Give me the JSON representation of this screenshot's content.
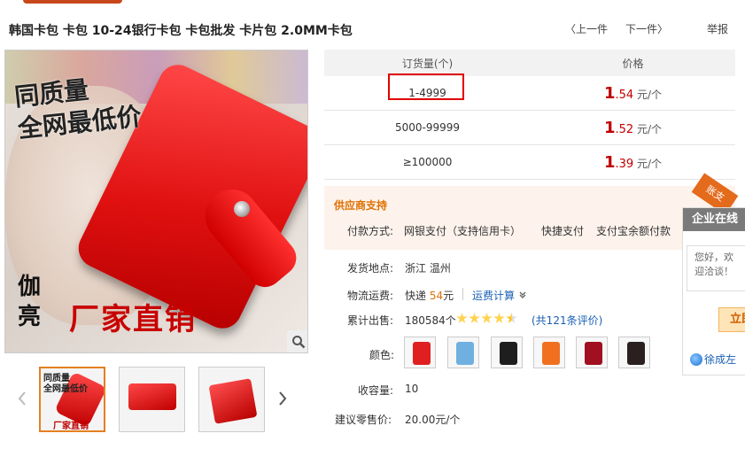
{
  "product": {
    "title": "韩国卡包 卡包 10-24银行卡包 卡包批发 卡片包 2.0MM卡包"
  },
  "nav": {
    "prev": "〈上一件",
    "next": "下一件〉",
    "report": "举报"
  },
  "image": {
    "promo_line1": "同质量",
    "promo_line2": "全网最低价",
    "brand_chars": "伽亮",
    "promo_bottom": "厂家直销",
    "thumbs": [
      {
        "line1": "同质量",
        "line2": "全网最低价",
        "bottom": "厂家直销"
      },
      {
        "line1": "",
        "line2": "",
        "bottom": ""
      },
      {
        "line1": "",
        "line2": "",
        "bottom": ""
      }
    ]
  },
  "price_table": {
    "col_qty": "订货量(个)",
    "col_price": "价格",
    "rows": [
      {
        "qty": "1-4999",
        "int": "1",
        "dec": ".54",
        "unit": "元/个"
      },
      {
        "qty": "5000-99999",
        "int": "1",
        "dec": ".52",
        "unit": "元/个"
      },
      {
        "qty": "≥100000",
        "int": "1",
        "dec": ".39",
        "unit": "元/个"
      }
    ]
  },
  "support": {
    "title": "供应商支持",
    "pay_label": "付款方式:",
    "pay_methods": [
      "网银支付（支持信用卡）",
      "快捷支付",
      "支付宝余额付款"
    ],
    "badge": "账支"
  },
  "details": {
    "ship_label": "发货地点:",
    "ship_value": "浙江 温州",
    "freight_label": "物流运费:",
    "freight_prefix": "快递",
    "freight_amount": "54",
    "freight_suffix": "元",
    "freight_calc": "运费计算",
    "sold_label": "累计出售:",
    "sold_value": "180584个",
    "rating": 4.5,
    "reviews": "(共121条评价)",
    "color_label": "颜色:",
    "stock_label": "收容量:",
    "stock_value": "10",
    "retail_label": "建议零售价:",
    "retail_value": "20.00元/个"
  },
  "colors": [
    "#e02020",
    "#6fb0e0",
    "#1e1e1e",
    "#f07020",
    "#a01020",
    "#2a2020"
  ],
  "chat": {
    "title": "企业在线",
    "message": "您好，欢迎洽谈！",
    "button": "立即",
    "user": "徐成左"
  }
}
